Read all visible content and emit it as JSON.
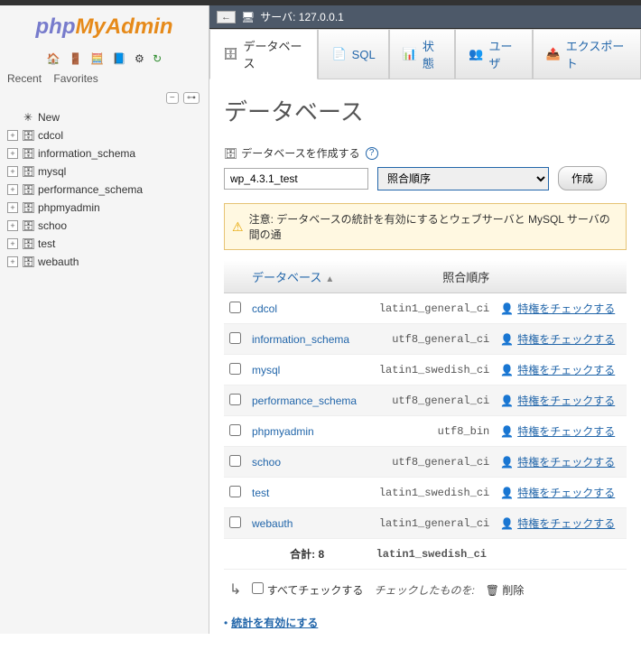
{
  "logo": {
    "php": "php",
    "myadmin": "MyAdmin"
  },
  "sidebarTabs": {
    "recent": "Recent",
    "favorites": "Favorites"
  },
  "tree": [
    {
      "label": "New",
      "new": true
    },
    {
      "label": "cdcol"
    },
    {
      "label": "information_schema"
    },
    {
      "label": "mysql"
    },
    {
      "label": "performance_schema"
    },
    {
      "label": "phpmyadmin"
    },
    {
      "label": "schoo"
    },
    {
      "label": "test"
    },
    {
      "label": "webauth"
    }
  ],
  "server": {
    "label": "サーバ:",
    "host": "127.0.0.1"
  },
  "mainTabs": [
    {
      "label": "データベース",
      "active": true,
      "icon": "🗄"
    },
    {
      "label": "SQL",
      "icon": "📄"
    },
    {
      "label": "状態",
      "icon": "📊"
    },
    {
      "label": "ユーザ",
      "icon": "👥"
    },
    {
      "label": "エクスポート",
      "icon": "📤"
    }
  ],
  "pageTitle": "データベース",
  "create": {
    "label": "データベースを作成する",
    "value": "wp_4.3.1_test",
    "collationPlaceholder": "照合順序",
    "button": "作成"
  },
  "notice": "注意: データベースの統計を有効にするとウェブサーバと MySQL サーバの間の通",
  "tableHeaders": {
    "db": "データベース",
    "collation": "照合順序"
  },
  "rows": [
    {
      "name": "cdcol",
      "collation": "latin1_general_ci"
    },
    {
      "name": "information_schema",
      "collation": "utf8_general_ci"
    },
    {
      "name": "mysql",
      "collation": "latin1_swedish_ci"
    },
    {
      "name": "performance_schema",
      "collation": "utf8_general_ci"
    },
    {
      "name": "phpmyadmin",
      "collation": "utf8_bin"
    },
    {
      "name": "schoo",
      "collation": "utf8_general_ci"
    },
    {
      "name": "test",
      "collation": "latin1_swedish_ci"
    },
    {
      "name": "webauth",
      "collation": "latin1_general_ci"
    }
  ],
  "privLabel": "特権をチェックする",
  "totals": {
    "label": "合計: 8",
    "collation": "latin1_swedish_ci"
  },
  "footer": {
    "checkAll": "すべてチェックする",
    "withSelected": "チェックしたものを:",
    "delete": "削除",
    "enableStats": "統計を有効にする"
  }
}
